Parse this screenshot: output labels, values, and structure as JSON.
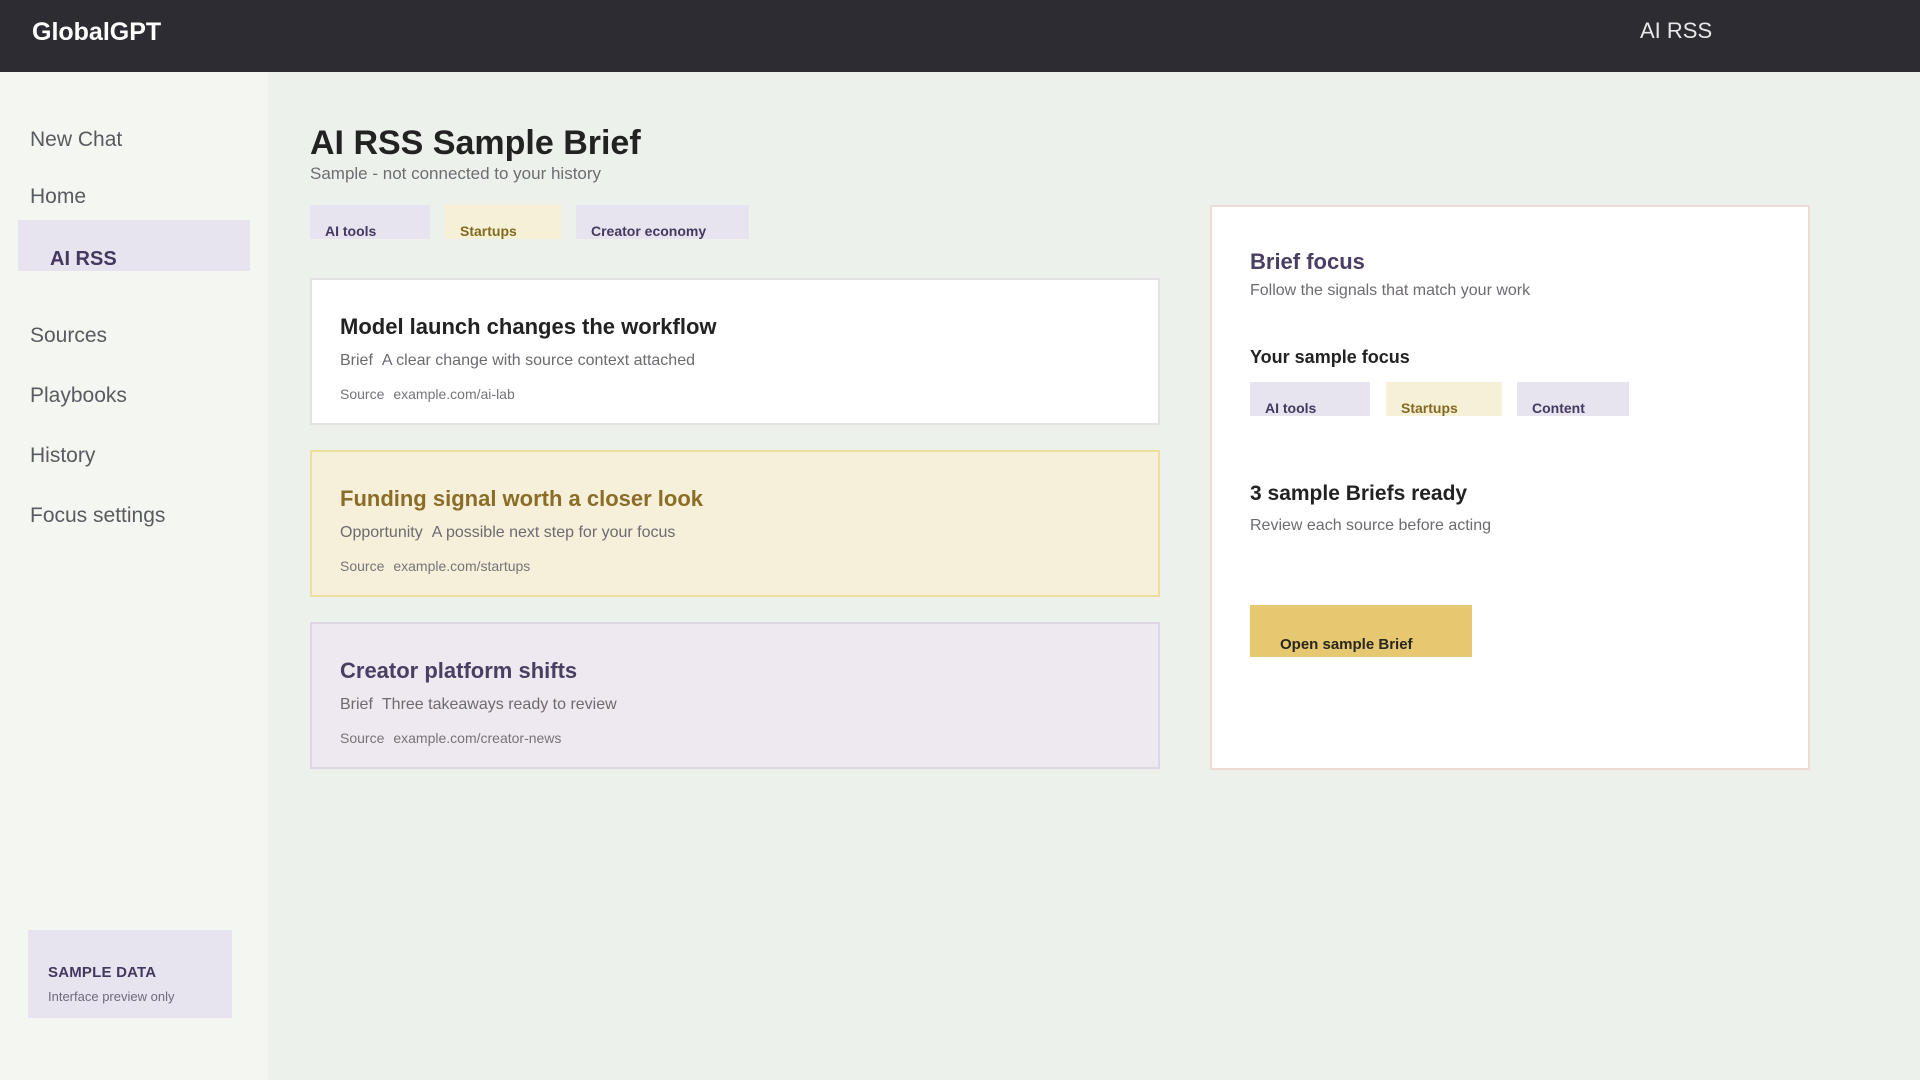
{
  "header": {
    "brand": "GlobalGPT",
    "nav_label": "AI RSS"
  },
  "sidebar": {
    "items": [
      {
        "label": "New Chat"
      },
      {
        "label": "Home"
      },
      {
        "label": "AI RSS",
        "active": true
      },
      {
        "label": "Sources"
      },
      {
        "label": "Playbooks"
      },
      {
        "label": "History"
      },
      {
        "label": "Focus settings"
      }
    ],
    "sample_box": {
      "title": "SAMPLE DATA",
      "subtitle": "Interface preview only"
    }
  },
  "main": {
    "title": "AI RSS Sample Brief",
    "subtitle": "Sample - not connected to your history",
    "tags": [
      "AI tools",
      "Startups",
      "Creator economy"
    ],
    "cards": [
      {
        "title": "Model launch changes the workflow",
        "type": "Brief",
        "description": "A clear change with source context attached",
        "source_label": "Source",
        "source": "example.com/ai-lab"
      },
      {
        "title": "Funding signal worth a closer look",
        "type": "Opportunity",
        "description": "A possible next step for your focus",
        "source_label": "Source",
        "source": "example.com/startups"
      },
      {
        "title": "Creator platform shifts",
        "type": "Brief",
        "description": "Three takeaways ready to review",
        "source_label": "Source",
        "source": "example.com/creator-news"
      }
    ]
  },
  "panel": {
    "title": "Brief focus",
    "subtitle": "Follow the signals that match your work",
    "focus_heading": "Your sample focus",
    "focus_tags": [
      "AI tools",
      "Startups",
      "Content"
    ],
    "count_text": "3 sample Briefs ready",
    "note": "Review each source before acting",
    "button_label": "Open sample Brief"
  },
  "colors": {
    "topbar": "#2e2c33",
    "lavender": "#e8e4ef",
    "yellow_soft": "#f6f0d6",
    "accent_button": "#e5c86f",
    "brand_purple": "#4a3e63"
  }
}
